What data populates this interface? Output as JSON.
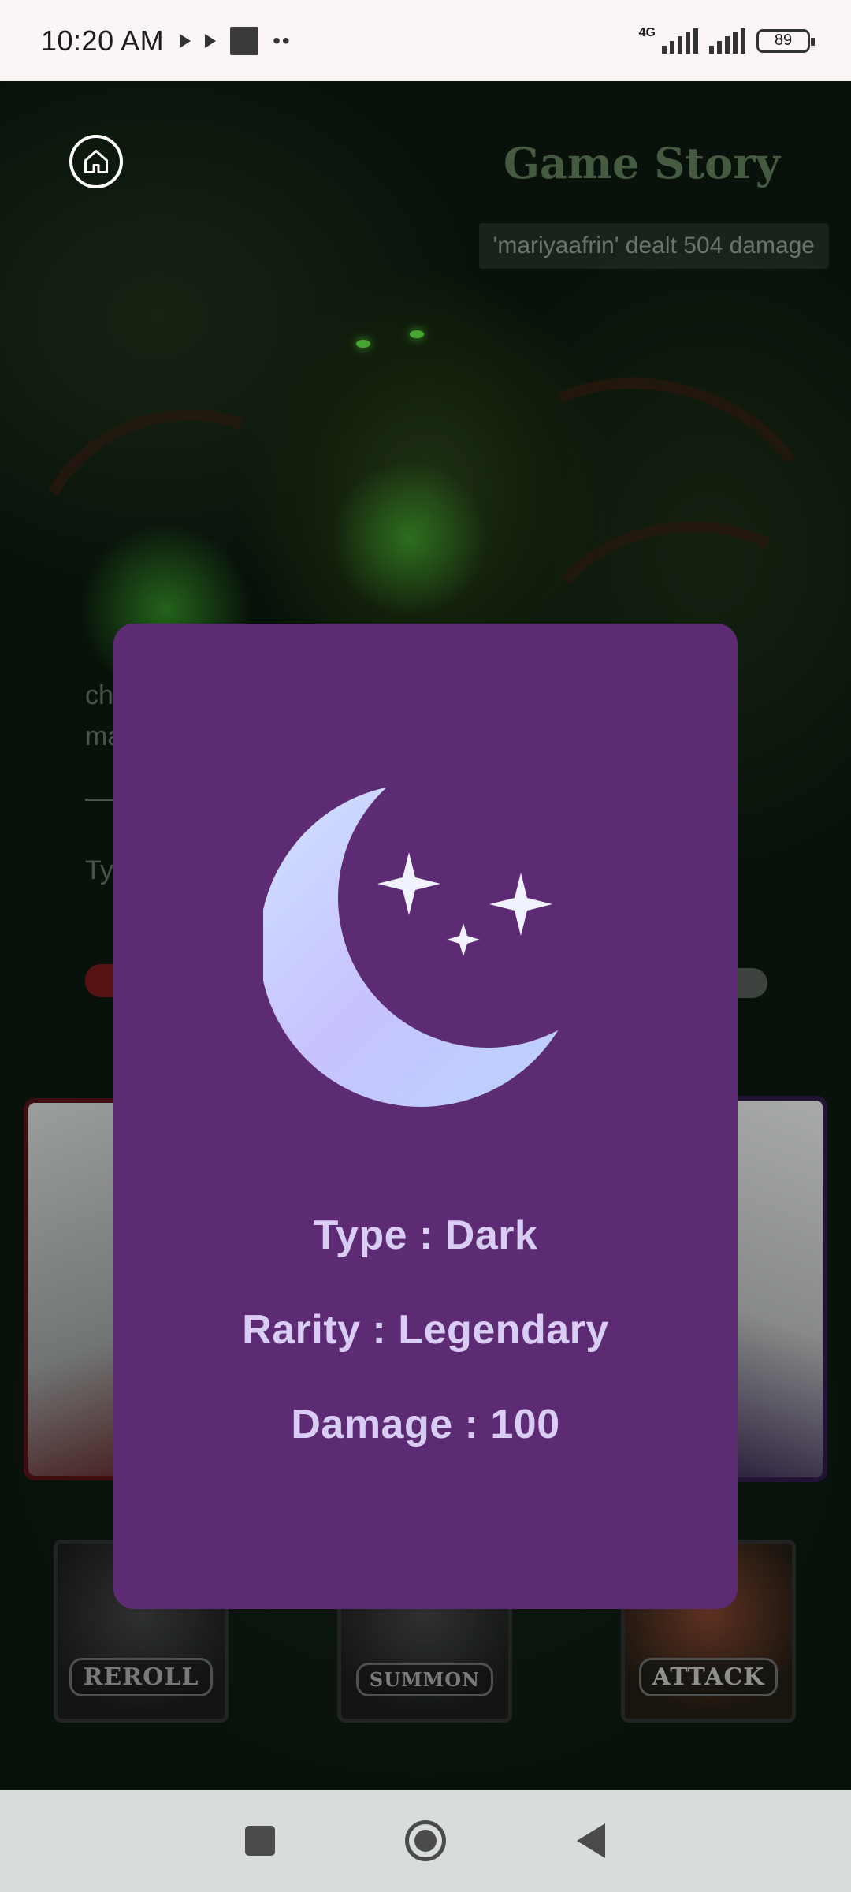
{
  "status_bar": {
    "time": "10:20 AM",
    "network": "4G",
    "battery": "89"
  },
  "game": {
    "title": "Game Story",
    "log_message": "'mariyaafrin' dealt 504 damage",
    "chat_fragment_1": "ch",
    "chat_fragment_2": "ma",
    "input_fragment": "Ty",
    "buttons": {
      "reroll": "REROLL",
      "summon": "SUMMON",
      "attack": "ATTACK"
    }
  },
  "card_popup": {
    "icon": "crescent-moon-stars-icon",
    "type_line": "Type : Dark",
    "rarity_line": "Rarity : Legendary",
    "damage_line": "Damage : 100",
    "colors": {
      "background": "#5d2b74",
      "text": "#d9cdf6"
    }
  }
}
